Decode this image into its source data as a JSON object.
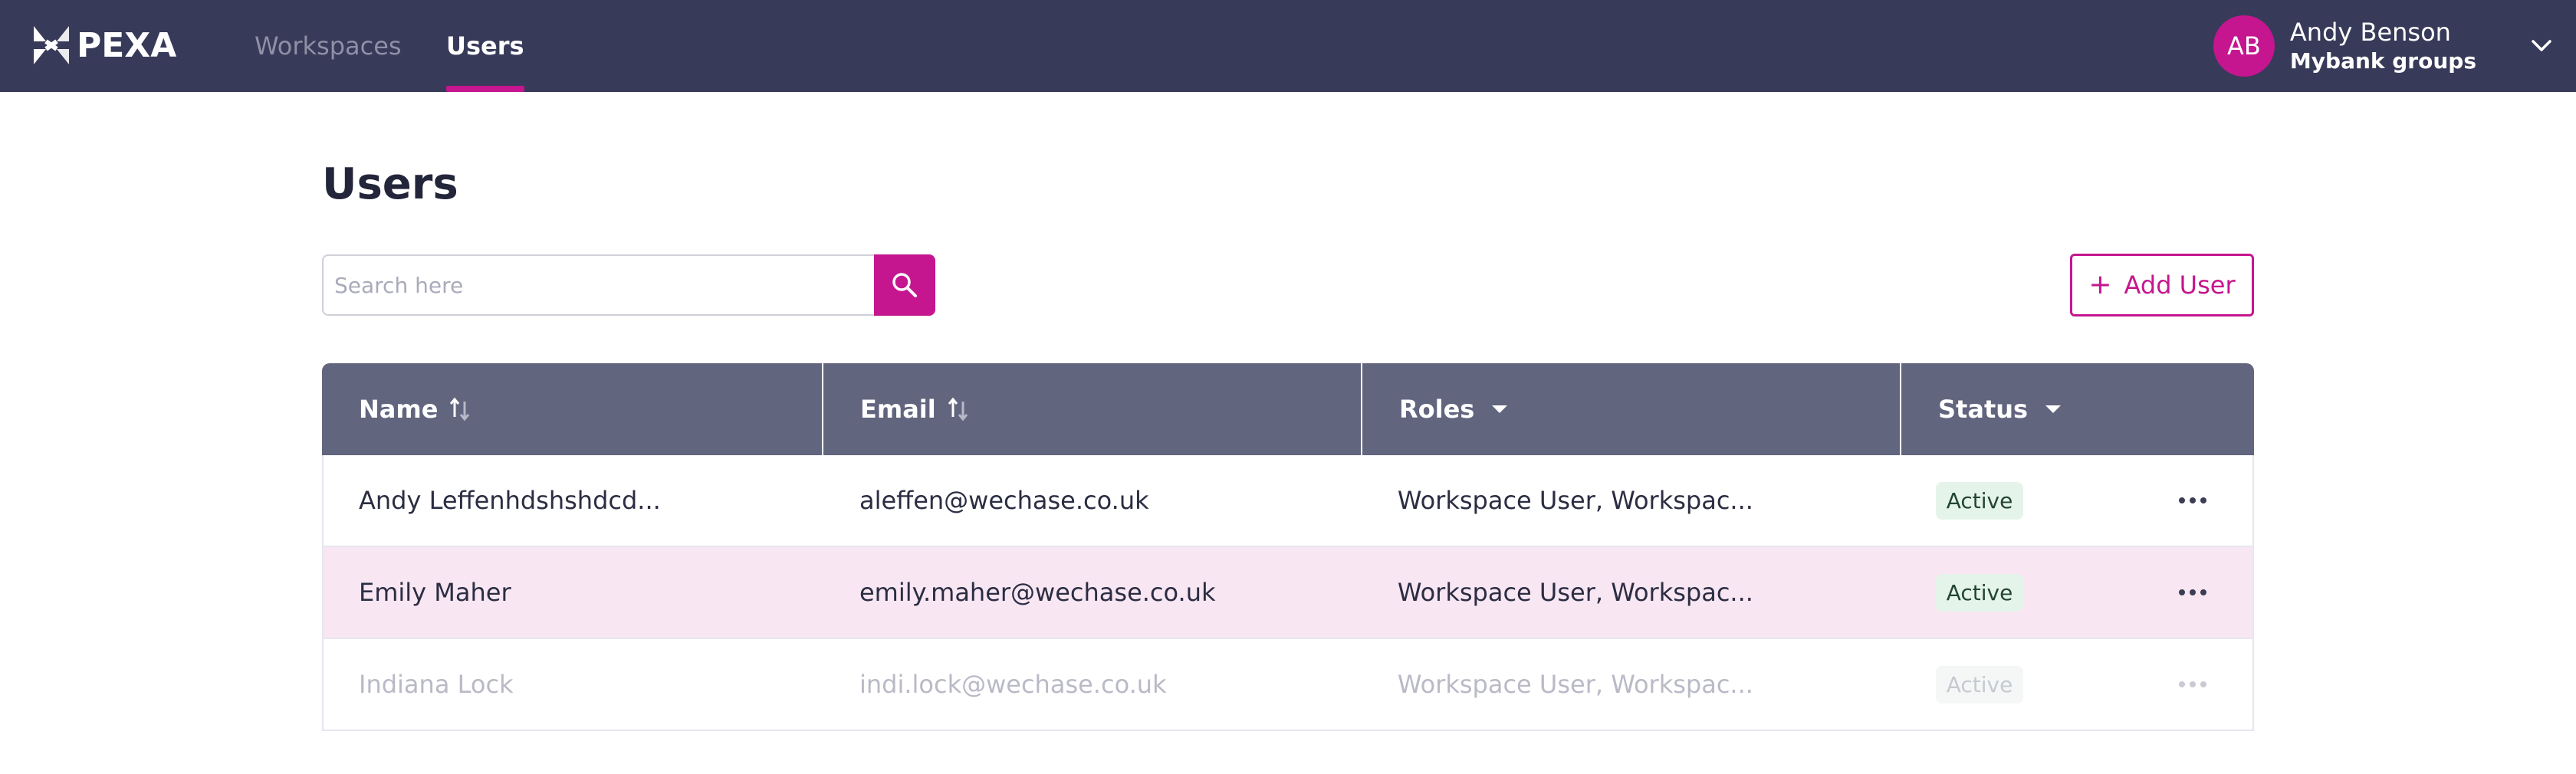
{
  "brand": {
    "logo_text": "PEXA",
    "accent": "#c5168f",
    "nav_bg": "#383a59"
  },
  "nav": {
    "tabs": [
      {
        "label": "Workspaces",
        "active": false
      },
      {
        "label": "Users",
        "active": true
      }
    ]
  },
  "user": {
    "initials": "AB",
    "name": "Andy Benson",
    "org": "Mybank groups"
  },
  "page": {
    "title": "Users"
  },
  "search": {
    "placeholder": "Search here",
    "value": ""
  },
  "actions": {
    "add_user_label": "Add User"
  },
  "table": {
    "headers": {
      "name": "Name",
      "email": "Email",
      "roles": "Roles",
      "status": "Status"
    },
    "rows": [
      {
        "name": "Andy Leffenhdshshdcd...",
        "email": "aleffen@wechase.co.uk",
        "roles": "Workspace User, Workspac...",
        "status": "Active"
      },
      {
        "name": "Emily Maher",
        "email": "emily.maher@wechase.co.uk",
        "roles": "Workspace User, Workspac...",
        "status": "Active"
      },
      {
        "name": "Indiana Lock",
        "email": "indi.lock@wechase.co.uk",
        "roles": "Workspace User, Workspac...",
        "status": "Active"
      }
    ]
  }
}
